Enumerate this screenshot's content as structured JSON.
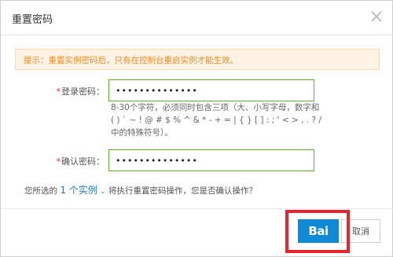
{
  "dialog": {
    "title": "重置密码",
    "notice": "提示：重置实例密码后，只有在控制台重启实例才能生效。",
    "login_password": {
      "required_mark": "*",
      "label": "登录密码：",
      "value": "••••••••••••••"
    },
    "password_hint": "8-30个字符，必须同时包含三项（大、小写字母，数字和( ) ` ~ ! @ # $ % ^ & * - + = | { } [ ] : ; ' < > , . ? / 中的特殊符号）。",
    "confirm_password": {
      "required_mark": "*",
      "label": "确认密码：",
      "value": "••••••••••••••"
    },
    "confirm": {
      "prefix": "您所选的",
      "link": "1 个实例",
      "chevron": "⌄",
      "suffix": "将执行重置密码操作，您是否确认操作？"
    },
    "buttons": {
      "ok_label": "Bai",
      "cancel_label": "取消"
    }
  },
  "colors": {
    "notice_text": "#f28a1e",
    "notice_bg": "#fff3e6",
    "input_border": "#5fb51f",
    "link": "#2a7bd3",
    "primary": "#0f8ad6",
    "highlight": "#e8242c"
  },
  "icons": {
    "close": "close-icon",
    "chevron": "chevron-down-icon"
  }
}
